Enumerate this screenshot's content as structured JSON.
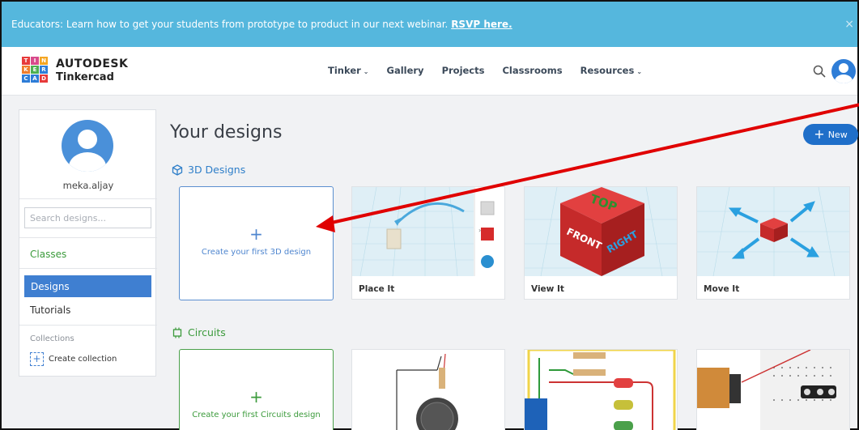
{
  "banner": {
    "text": "Educators: Learn how to get your students from prototype to product in our next webinar. ",
    "link": "RSVP here.",
    "close": "×"
  },
  "header": {
    "logo_letters": [
      "T",
      "I",
      "N",
      "K",
      "E",
      "R",
      "C",
      "A",
      "D"
    ],
    "logo_colors": [
      "#e73a3a",
      "#d84a8c",
      "#f5a623",
      "#ef7d2b",
      "#4caf50",
      "#2e7dd7",
      "#2e7dd7",
      "#2e7dd7",
      "#e73a3a"
    ],
    "brand_top": "AUTODESK",
    "brand_bottom": "Tinkercad",
    "nav": [
      {
        "label": "Tinker",
        "dropdown": true
      },
      {
        "label": "Gallery",
        "dropdown": false
      },
      {
        "label": "Projects",
        "dropdown": false
      },
      {
        "label": "Classrooms",
        "dropdown": false
      },
      {
        "label": "Resources",
        "dropdown": true
      }
    ]
  },
  "sidebar": {
    "username": "meka.aljay",
    "search_placeholder": "Search designs...",
    "classes": "Classes",
    "designs": "Designs",
    "tutorials": "Tutorials",
    "collections": "Collections",
    "create_collection": "Create collection"
  },
  "main": {
    "title": "Your designs",
    "new_button": "New",
    "section_3d": "3D Designs",
    "section_circuits": "Circuits",
    "create_3d": "Create your first 3D design",
    "create_circuits": "Create your first Circuits design",
    "cards_3d": [
      "Place It",
      "View It",
      "Move It"
    ]
  },
  "colors": {
    "banner": "#55b7dd",
    "accent": "#1f6fc9",
    "circuits": "#3b9a3b",
    "annotation_arrow": "#e00000"
  }
}
